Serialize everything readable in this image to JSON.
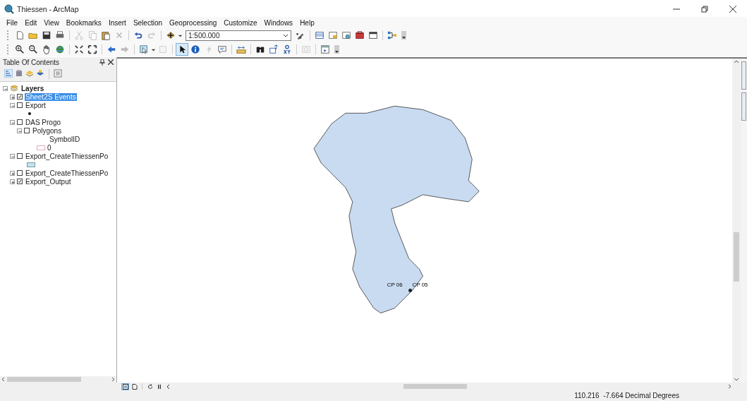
{
  "window": {
    "title": "Thiessen - ArcMap"
  },
  "menu": [
    "File",
    "Edit",
    "View",
    "Bookmarks",
    "Insert",
    "Selection",
    "Geoprocessing",
    "Customize",
    "Windows",
    "Help"
  ],
  "toolbar": {
    "scale": "1:500.000"
  },
  "toc": {
    "title": "Table Of Contents",
    "tree": [
      {
        "label": "Layers",
        "kind": "group",
        "expanded": true,
        "selected": false,
        "children": [
          {
            "label": "Sheet2S Events",
            "kind": "layer",
            "expanded": false,
            "checked": true,
            "selected": true
          },
          {
            "label": "Export",
            "kind": "layer",
            "expanded": true,
            "checked": false,
            "selected": false,
            "legend": [
              {
                "kind": "point"
              }
            ]
          },
          {
            "label": "DAS Progo",
            "kind": "layer",
            "expanded": true,
            "checked": false,
            "selected": false,
            "children": [
              {
                "label": "Polygons",
                "kind": "layer",
                "expanded": true,
                "checked": false,
                "selected": false,
                "legend": [
                  {
                    "kind": "heading",
                    "label": "SymbolID"
                  },
                  {
                    "kind": "swatch-outline",
                    "label": "0",
                    "color": "#e6a9c2"
                  }
                ]
              }
            ]
          },
          {
            "label": "Export_CreateThiessenPo",
            "kind": "layer",
            "expanded": true,
            "checked": false,
            "selected": false,
            "legend": [
              {
                "kind": "swatch",
                "color": "#c4e4ec"
              }
            ]
          },
          {
            "label": "Export_CreateThiessenPo",
            "kind": "layer",
            "expanded": false,
            "checked": false,
            "selected": false
          },
          {
            "label": "Export_Output",
            "kind": "layer",
            "expanded": false,
            "checked": true,
            "selected": false
          }
        ]
      }
    ]
  },
  "map": {
    "labels": [
      "CP 06",
      "CP 05"
    ]
  },
  "status_bar": {
    "coordinates": "110.216  -7.664 Decimal Degrees"
  }
}
